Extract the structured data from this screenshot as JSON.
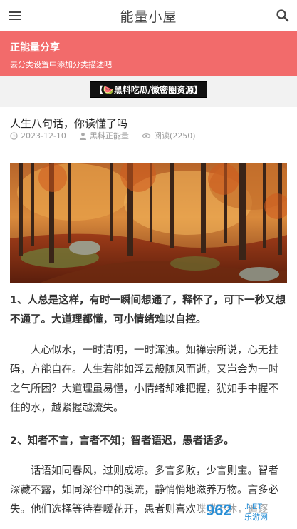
{
  "header": {
    "title": "能量小屋",
    "menu_icon": "menu-icon",
    "search_icon": "search-icon"
  },
  "category": {
    "title": "正能量分享",
    "description": "去分类设置中添加分类描述吧",
    "color": "#f26b6b"
  },
  "ad": {
    "label": "【🍉黑料吃瓜/微密圈资源】"
  },
  "article": {
    "title": "人生八句话，你读懂了吗",
    "date": "2023-12-10",
    "author": "黑料正能量",
    "views": "阅读(2250)",
    "paragraphs": [
      "1、人总是这样，有时一瞬间想通了，释怀了，可下一秒又想不通了。大道理都懂，可小情绪难以自控。",
      "人心似水，一时清明，一时浑浊。如禅宗所说，心无挂碍，方能自在。人生若能如浮云般随风而逝，又岂会为一时之气所困？大道理虽易懂，小情绪却难把握，犹如手中握不住的水，越紧握越流失。",
      "2、知者不言，言者不知；智者语迟，愚者话多。",
      "话语如同春风，过则成凉。多言多败，少言则宝。智者深藏不露，如同深谷中的溪流，静悄悄地滋养万物。言多必失。他们选择等待春暖花开，愚者则喜欢喋喋不休，追逐"
    ]
  },
  "watermark": {
    "text": "962.net",
    "subtext": "乐游网"
  }
}
